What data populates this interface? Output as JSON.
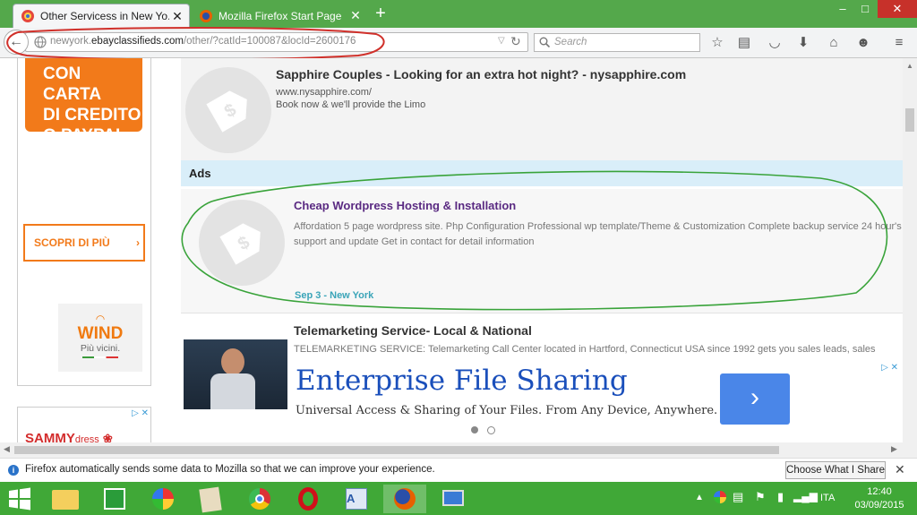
{
  "browser": {
    "tabs": [
      {
        "label": "Other Servicess in New Yo...",
        "active": true
      },
      {
        "label": "Mozilla Firefox Start Page",
        "active": false
      }
    ],
    "new_tab_symbol": "+",
    "window_controls": [
      "–",
      "□",
      "✕"
    ],
    "url": {
      "prefix": "newyork.",
      "domain": "ebayclassifieds.com",
      "path": "/other/?catId=100087&locId=2600176"
    },
    "search_placeholder": "Search"
  },
  "sidebar_ads": {
    "carta": {
      "line1": "CON CARTA",
      "line2": "DI CREDITO",
      "line3": "O PAYPAL"
    },
    "scopri": "SCOPRI DI PIÙ",
    "wind": {
      "brand": "WIND",
      "slogan": "Più vicini."
    },
    "sammy": {
      "brand": "SAMMY",
      "suffix": "dress"
    }
  },
  "listings": [
    {
      "title": "Sapphire Couples - Looking for an extra hot night? - nysapphire.com",
      "url": "www.nysapphire.com/",
      "desc": "Book now & we'll provide the Limo"
    },
    {
      "title": "Cheap Wordpress Hosting & Installation",
      "desc": "Affordation 5 page wordpress site. Php Configuration Professional wp template/Theme & Customization Complete backup service 24 hour's support and update Get in contact for detail information",
      "meta": "Sep 3 - New York"
    },
    {
      "title": "Telemarketing Service- Local & National",
      "desc": "TELEMARKETING SERVICE: Telemarketing Call Center located in Hartford, Connecticut USA since 1992 gets you sales leads, sales"
    }
  ],
  "ads_header": "Ads",
  "banner": {
    "title": "Enterprise File Sharing",
    "subtitle": "Universal Access & Sharing of Your Files. From Any Device, Anywhere."
  },
  "notice": {
    "text": "Firefox automatically sends some data to Mozilla so that we can improve your experience.",
    "button": "Choose What I Share"
  },
  "tray": {
    "lang": "ITA",
    "time": "12:40",
    "date": "03/09/2015"
  },
  "colors": {
    "tab_green": "#54a84b",
    "taskbar_green": "#40a837",
    "link_purple": "#5a2a82",
    "ads_bar": "#d9eef9",
    "banner_blue": "#1a4fbb"
  }
}
